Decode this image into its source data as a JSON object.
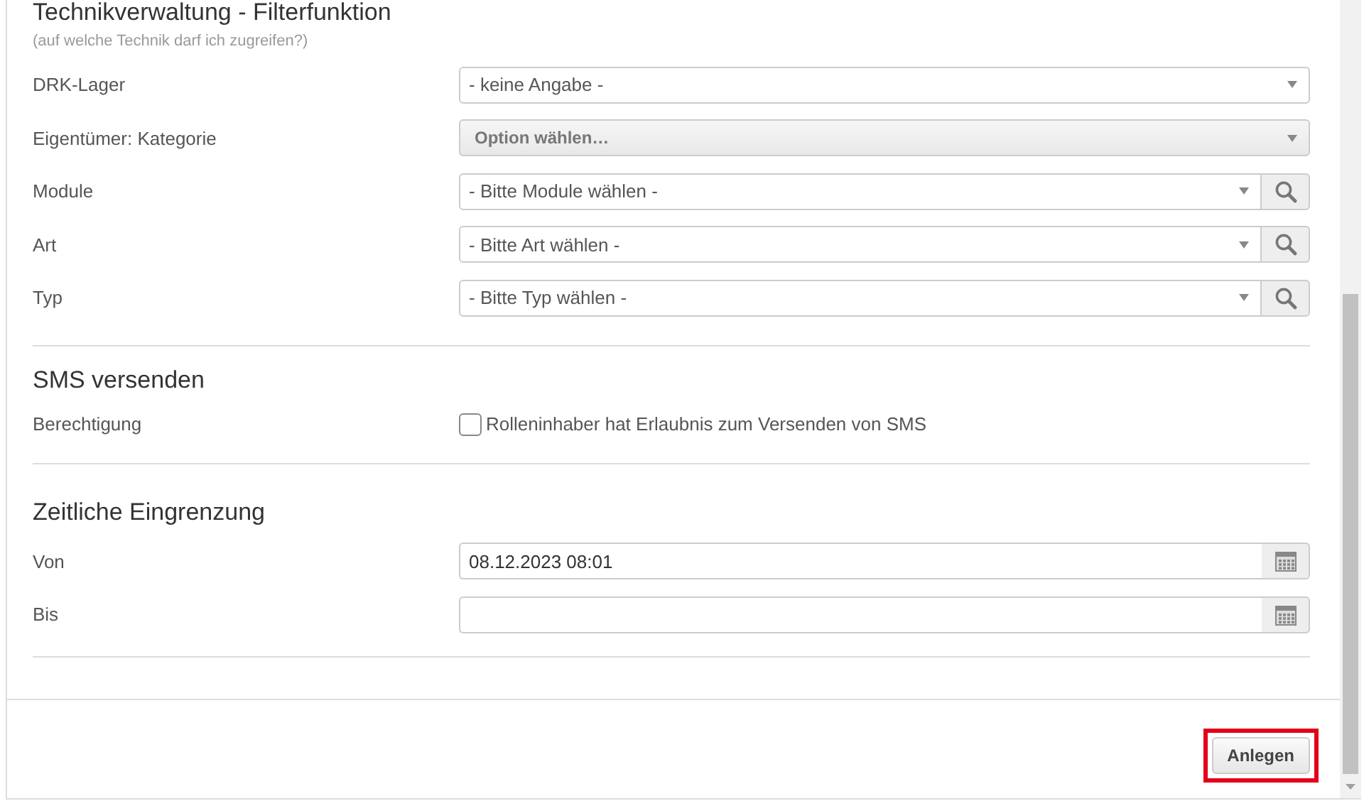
{
  "section_title": "Technikverwaltung - Filterfunktion",
  "section_hint": "(auf welche Technik darf ich zugreifen?)",
  "filter_fields": [
    {
      "label": "DRK-Lager",
      "kind": "select",
      "value": "- keine Angabe -"
    },
    {
      "label": "Eigentümer: Kategorie",
      "kind": "multiselect",
      "placeholder": "Option wählen…"
    },
    {
      "label": "Module",
      "kind": "select_search",
      "value": "- Bitte Module wählen -"
    },
    {
      "label": "Art",
      "kind": "select_search",
      "value": "- Bitte Art wählen -"
    },
    {
      "label": "Typ",
      "kind": "select_search",
      "value": "- Bitte Typ wählen -"
    }
  ],
  "sms": {
    "title": "SMS versenden",
    "label": "Berechtigung",
    "checkbox": {
      "text": "Rolleninhaber hat Erlaubnis zum Versenden von SMS",
      "checked": false
    }
  },
  "time": {
    "title": "Zeitliche Eingrenzung",
    "fields": [
      {
        "label": "Von",
        "value": "08.12.2023 08:01"
      },
      {
        "label": "Bis"
      }
    ]
  },
  "footer": {
    "button": {
      "label": "Anlegen",
      "highlighted": true
    }
  }
}
